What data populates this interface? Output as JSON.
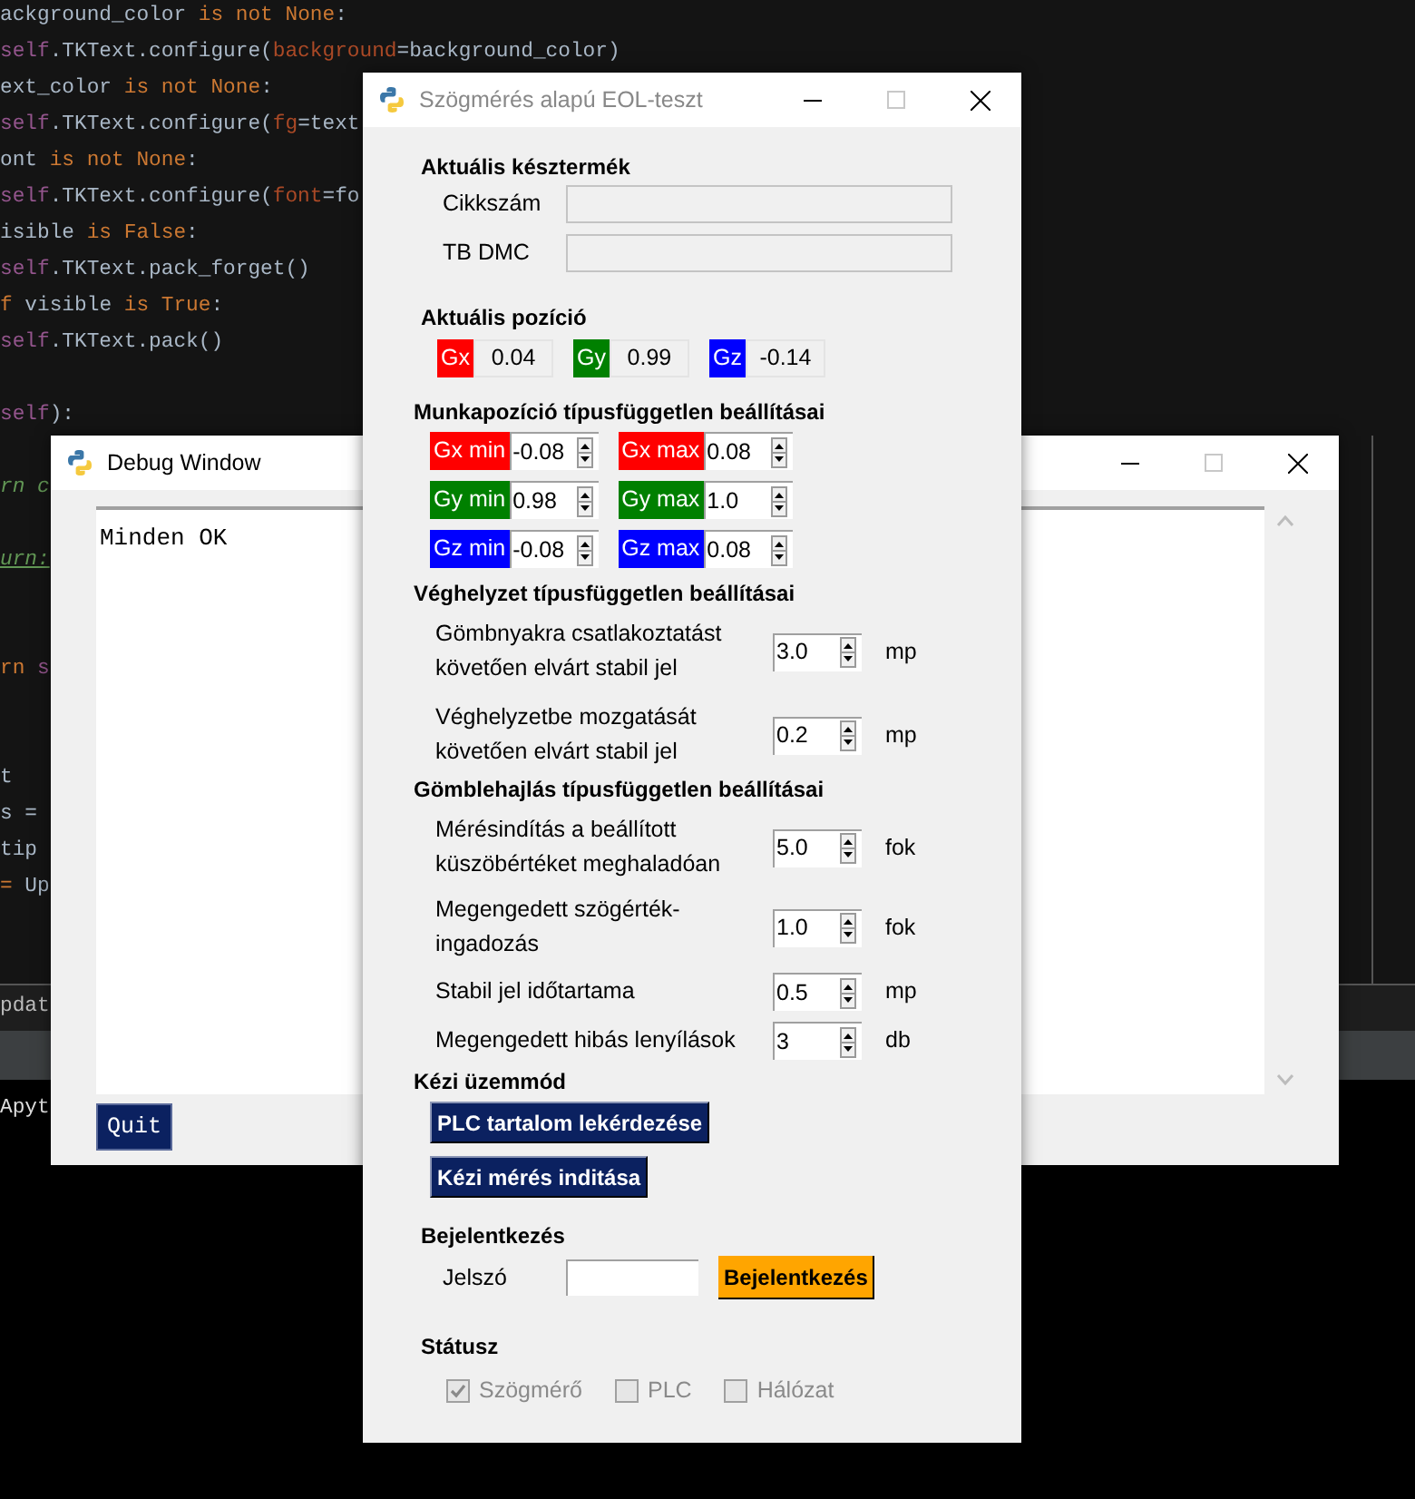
{
  "editor": {
    "lines": [
      {
        "tokens": [
          {
            "kind": "plain",
            "text": "ackground_color"
          },
          {
            "kind": "keyword",
            "text": " is not None"
          },
          {
            "kind": "plain",
            "text": ":"
          }
        ]
      },
      {
        "tokens": [
          {
            "kind": "self",
            "text": "self"
          },
          {
            "kind": "plain",
            "text": ".TKText.configure("
          },
          {
            "kind": "param",
            "text": "background"
          },
          {
            "kind": "plain",
            "text": "=background_color)"
          }
        ]
      },
      {
        "tokens": [
          {
            "kind": "plain",
            "text": "ext_color"
          },
          {
            "kind": "keyword",
            "text": " is not None"
          },
          {
            "kind": "plain",
            "text": ":"
          }
        ]
      },
      {
        "tokens": [
          {
            "kind": "self",
            "text": "self"
          },
          {
            "kind": "plain",
            "text": ".TKText.configure("
          },
          {
            "kind": "param",
            "text": "fg"
          },
          {
            "kind": "plain",
            "text": "=text"
          }
        ]
      },
      {
        "tokens": [
          {
            "kind": "plain",
            "text": "ont"
          },
          {
            "kind": "keyword",
            "text": " is not None"
          },
          {
            "kind": "plain",
            "text": ":"
          }
        ]
      },
      {
        "tokens": [
          {
            "kind": "self",
            "text": "self"
          },
          {
            "kind": "plain",
            "text": ".TKText.configure("
          },
          {
            "kind": "param",
            "text": "font"
          },
          {
            "kind": "plain",
            "text": "=fo"
          }
        ]
      },
      {
        "tokens": [
          {
            "kind": "plain",
            "text": "isible"
          },
          {
            "kind": "keyword",
            "text": " is False"
          },
          {
            "kind": "plain",
            "text": ":"
          }
        ]
      },
      {
        "tokens": [
          {
            "kind": "self",
            "text": "self"
          },
          {
            "kind": "plain",
            "text": ".TKText.pack_forget()"
          }
        ]
      },
      {
        "tokens": [
          {
            "kind": "keyword",
            "text": "f"
          },
          {
            "kind": "plain",
            "text": " visible"
          },
          {
            "kind": "keyword",
            "text": " is True"
          },
          {
            "kind": "plain",
            "text": ":"
          }
        ]
      },
      {
        "tokens": [
          {
            "kind": "self",
            "text": "self"
          },
          {
            "kind": "plain",
            "text": ".TKText.pack()"
          }
        ]
      },
      {
        "kind": "blank"
      },
      {
        "tokens": [
          {
            "kind": "self",
            "text": "self"
          },
          {
            "kind": "plain",
            "text": "):"
          }
        ]
      },
      {
        "kind": "blank"
      },
      {
        "tokens": [
          {
            "kind": "comment",
            "text": "rn c"
          }
        ]
      },
      {
        "kind": "blank"
      },
      {
        "tokens": [
          {
            "kind": "link",
            "text": "urn:"
          }
        ]
      },
      {
        "kind": "blank"
      },
      {
        "kind": "blank"
      },
      {
        "tokens": [
          {
            "kind": "keyword",
            "text": "rn"
          },
          {
            "kind": "self",
            "text": " s"
          }
        ]
      },
      {
        "kind": "blank"
      },
      {
        "kind": "blank"
      },
      {
        "tokens": [
          {
            "kind": "plain",
            "text": "t"
          }
        ]
      },
      {
        "tokens": [
          {
            "kind": "plain",
            "text": "s ="
          }
        ]
      },
      {
        "tokens": [
          {
            "kind": "plain",
            "text": "tip"
          }
        ]
      },
      {
        "tokens": [
          {
            "kind": "keyword",
            "text": "="
          },
          {
            "kind": "plain",
            "text": " Up"
          }
        ]
      }
    ],
    "bottom_tab": "pdat",
    "terminal": "Apyt"
  },
  "debug_window": {
    "title": "Debug Window",
    "output": "Minden OK",
    "button": "Quit"
  },
  "main_window": {
    "title": "Szögmérés alapú EOL-teszt",
    "product": {
      "heading": "Aktuális késztermék",
      "fields": [
        {
          "label": "Cikkszám",
          "disabled": true
        },
        {
          "label": "TB DMC",
          "disabled": true
        }
      ]
    },
    "position": {
      "heading": "Aktuális pozíció",
      "readings": [
        {
          "axis": "Gx",
          "value": "0.04",
          "color": "#ff0000"
        },
        {
          "axis": "Gy",
          "value": "0.99",
          "color": "#008000"
        },
        {
          "axis": "Gz",
          "value": "-0.14",
          "color": "#0000ff"
        }
      ]
    },
    "work_position": {
      "heading": "Munkapozíció típusfüggetlen beállításai",
      "limits": [
        {
          "label": "Gx min",
          "value": "-0.08",
          "color": "#ff0000"
        },
        {
          "label": "Gx max",
          "value": "0.08",
          "color": "#ff0000"
        },
        {
          "label": "Gy min",
          "value": "0.98",
          "color": "#008000"
        },
        {
          "label": "Gy max",
          "value": "1.0",
          "color": "#008000"
        },
        {
          "label": "Gz min",
          "value": "-0.08",
          "color": "#0000ff"
        },
        {
          "label": "Gz max",
          "value": "0.08",
          "color": "#0000ff"
        }
      ]
    },
    "end_position": {
      "heading": "Véghelyzet típusfüggetlen beállításai",
      "settings": [
        {
          "label": "Gömbnyakra csatlakoztatást követően elvárt stabil jel",
          "value": "3.0",
          "unit": "mp"
        },
        {
          "label": "Véghelyzetbe mozgatását követően elvárt stabil jel",
          "value": "0.2",
          "unit": "mp"
        }
      ]
    },
    "deflection": {
      "heading": "Gömblehajlás típusfüggetlen beállításai",
      "settings": [
        {
          "label": "Mérésindítás a beállított küszöbértéket meghaladóan",
          "value": "5.0",
          "unit": "fok"
        },
        {
          "label": "Megengedett szögérték-ingadozás",
          "value": "1.0",
          "unit": "fok"
        },
        {
          "label": "Stabil jel időtartama",
          "value": "0.5",
          "unit": "mp"
        },
        {
          "label": "Megengedett hibás lenyílások",
          "value": "3",
          "unit": "db"
        }
      ]
    },
    "manual": {
      "heading": "Kézi üzemmód",
      "buttons": [
        "PLC tartalom lekérdezése",
        "Kézi mérés inditása"
      ]
    },
    "login": {
      "heading": "Bejelentkezés",
      "password_label": "Jelszó",
      "button": "Bejelentkezés"
    },
    "status": {
      "heading": "Státusz",
      "checks": [
        {
          "label": "Szögmérő",
          "checked": true,
          "disabled": true
        },
        {
          "label": "PLC",
          "checked": false,
          "disabled": true
        },
        {
          "label": "Hálózat",
          "checked": false,
          "disabled": true
        }
      ]
    }
  }
}
